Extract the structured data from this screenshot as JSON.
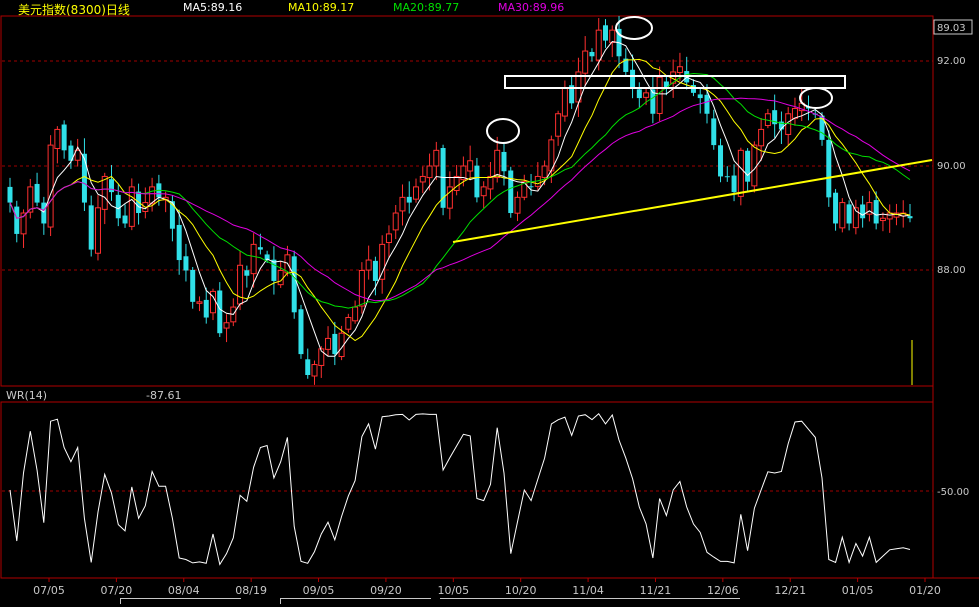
{
  "header": {
    "title": "美元指数(8300)日线",
    "ma5": "MA5:89.16",
    "ma10": "MA10:89.17",
    "ma20": "MA20:89.77",
    "ma30": "MA30:89.96"
  },
  "colors": {
    "background": "#000000",
    "frame": "#b00000",
    "grid": "#a00000",
    "axis_text": "#c8c8c8",
    "title": "#ffff00",
    "up": "#ff3030",
    "down": "#30e0e8",
    "ma5": "#ffffff",
    "ma10": "#ffff00",
    "ma20": "#00e000",
    "ma30": "#e000e0",
    "trendline": "#ffff00",
    "annotation": "#ffffff",
    "volume_bar": "#ffff00"
  },
  "chart_data": [
    {
      "type": "candlestick",
      "title": "美元指数(8300)日线",
      "series": [
        {
          "name": "MA5:89.16"
        },
        {
          "name": "MA10:89.17"
        },
        {
          "name": "MA20:89.77"
        },
        {
          "name": "MA30:89.96"
        }
      ],
      "ylim": [
        86.0,
        93.0
      ],
      "y_ticks": [
        "92.00",
        "90.00",
        "88.00"
      ],
      "last_price": "89.03",
      "grid": true,
      "x_tick_labels": [
        "07/05",
        "07/20",
        "08/04",
        "08/19",
        "09/05",
        "09/20",
        "10/05",
        "10/20",
        "11/04",
        "11/21",
        "12/06",
        "12/21",
        "01/05",
        "01/20"
      ],
      "closes": [
        89.3,
        88.7,
        89.1,
        89.6,
        89.3,
        88.9,
        90.4,
        90.7,
        90.3,
        90.1,
        90.3,
        89.3,
        88.4,
        89.2,
        89.8,
        89.5,
        89.0,
        88.9,
        89.6,
        89.1,
        89.3,
        89.6,
        89.4,
        89.4,
        88.8,
        88.2,
        88.0,
        87.4,
        87.4,
        87.1,
        87.6,
        86.8,
        87.0,
        87.3,
        88.1,
        87.9,
        88.5,
        88.4,
        88.2,
        87.8,
        88.0,
        88.3,
        87.2,
        86.4,
        86.0,
        86.2,
        86.5,
        86.7,
        86.4,
        86.8,
        87.1,
        87.3,
        88.0,
        88.2,
        87.8,
        88.5,
        88.7,
        89.1,
        89.4,
        89.3,
        89.6,
        89.8,
        90.0,
        90.3,
        89.2,
        89.6,
        89.8,
        90.0,
        90.1,
        89.4,
        89.6,
        89.8,
        90.3,
        89.9,
        89.1,
        89.4,
        89.7,
        89.6,
        89.8,
        90.0,
        90.5,
        91.0,
        91.5,
        91.2,
        91.8,
        92.2,
        92.1,
        92.6,
        92.4,
        92.6,
        92.1,
        91.8,
        91.5,
        91.3,
        91.4,
        91.0,
        91.7,
        91.5,
        91.8,
        91.9,
        91.6,
        91.4,
        91.3,
        91.0,
        90.4,
        89.8,
        89.8,
        89.5,
        90.3,
        89.7,
        90.4,
        90.7,
        91.0,
        90.8,
        90.7,
        91.0,
        91.1,
        91.2,
        91.1,
        91.0,
        90.5,
        89.4,
        88.9,
        89.3,
        88.9,
        89.2,
        89.0,
        89.3,
        88.9,
        89.0,
        89.1,
        89.1,
        89.1,
        89.0
      ],
      "ma5_last": 89.16,
      "ma10_last": 89.17,
      "ma20_last": 89.77,
      "ma30_last": 89.96,
      "annotations": [
        "trendline",
        "ellipse",
        "ellipse",
        "ellipse",
        "rectangle"
      ]
    },
    {
      "type": "line",
      "title": "WR(14)",
      "value_label": "-87.61",
      "y_ticks": [
        "-50.00"
      ],
      "ylim": [
        -100,
        0
      ],
      "grid": true
    }
  ],
  "footer_tabs": [
    "",
    "",
    ""
  ]
}
